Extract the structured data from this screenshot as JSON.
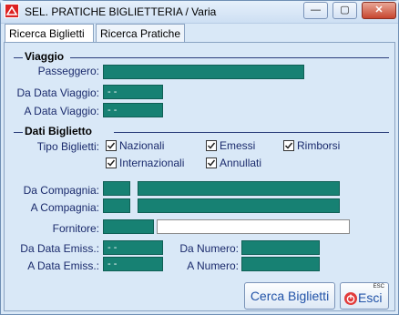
{
  "window": {
    "title": "SEL. PRATICHE BIGLIETTERIA / Varia",
    "min_label": "—",
    "max_label": "▢",
    "close_label": "✕"
  },
  "tabs": [
    {
      "label": "Ricerca Biglietti"
    },
    {
      "label": "Ricerca Pratiche"
    }
  ],
  "viaggio": {
    "title": "Viaggio",
    "passeggero_label": "Passeggero:",
    "passeggero_value": "",
    "da_data_label": "Da Data Viaggio:",
    "da_data_value": "- -",
    "a_data_label": "A  Data Viaggio:",
    "a_data_value": "- -"
  },
  "dati_biglietto": {
    "title": "Dati Biglietto",
    "tipo_label": "Tipo Biglietti:",
    "checkboxes": [
      {
        "label": "Nazionali",
        "checked": true
      },
      {
        "label": "Emessi",
        "checked": true
      },
      {
        "label": "Rimborsi",
        "checked": true
      },
      {
        "label": "Internazionali",
        "checked": true
      },
      {
        "label": "Annullati",
        "checked": true
      }
    ],
    "da_compagnia_label": "Da Compagnia:",
    "a_compagnia_label": "A Compagnia:",
    "fornitore_label": "Fornitore:",
    "da_data_emiss_label": "Da Data Emiss.:",
    "da_data_emiss_value": "- -",
    "a_data_emiss_label": "A  Data Emiss.:",
    "a_data_emiss_value": "- -",
    "da_numero_label": "Da Numero:",
    "a_numero_label": "A Numero:"
  },
  "buttons": {
    "search_label": "Cerca Biglietti",
    "exit_label": "Esci",
    "exit_hint": "ESC"
  },
  "colors": {
    "field_fill": "#178173",
    "close_button": "#c7462f",
    "accent_text": "#2253a8"
  }
}
